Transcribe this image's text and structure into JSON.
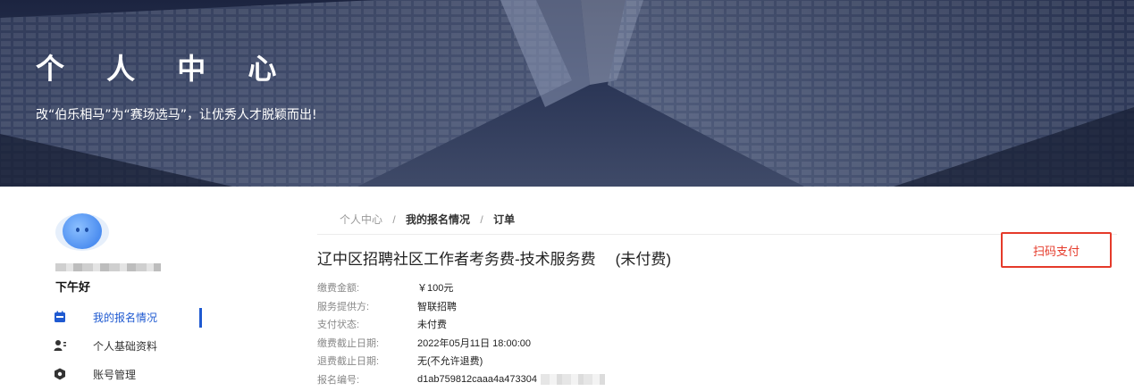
{
  "banner": {
    "title": "个 人 中 心",
    "subtitle": "改“伯乐相马”为“赛场选马”，让优秀人才脱颖而出!"
  },
  "sidebar": {
    "greeting": "下午好",
    "items": [
      {
        "label": "我的报名情况",
        "icon": "calendar-icon",
        "active": true
      },
      {
        "label": "个人基础资料",
        "icon": "user-card-icon",
        "active": false
      },
      {
        "label": "账号管理",
        "icon": "shield-icon",
        "active": false
      }
    ]
  },
  "breadcrumb": {
    "items": [
      "个人中心",
      "我的报名情况",
      "订单"
    ],
    "separator": "/"
  },
  "order": {
    "title": "辽中区招聘社区工作者考务费-技术服务费",
    "status": "(未付费)",
    "pay_button": "扫码支付",
    "fields": [
      {
        "label": "缴费金额:",
        "value": "￥100元"
      },
      {
        "label": "服务提供方:",
        "value": "智联招聘"
      },
      {
        "label": "支付状态:",
        "value": "未付费"
      },
      {
        "label": "缴费截止日期:",
        "value": "2022年05月11日 18:00:00"
      },
      {
        "label": "退费截止日期:",
        "value": "无(不允许退费)"
      },
      {
        "label": "报名编号:",
        "value": "d1ab759812caaa4a473304"
      }
    ]
  },
  "colors": {
    "accent": "#1f5ad1",
    "pay_button": "#e53a2a",
    "banner_dark": "#1c2440"
  }
}
